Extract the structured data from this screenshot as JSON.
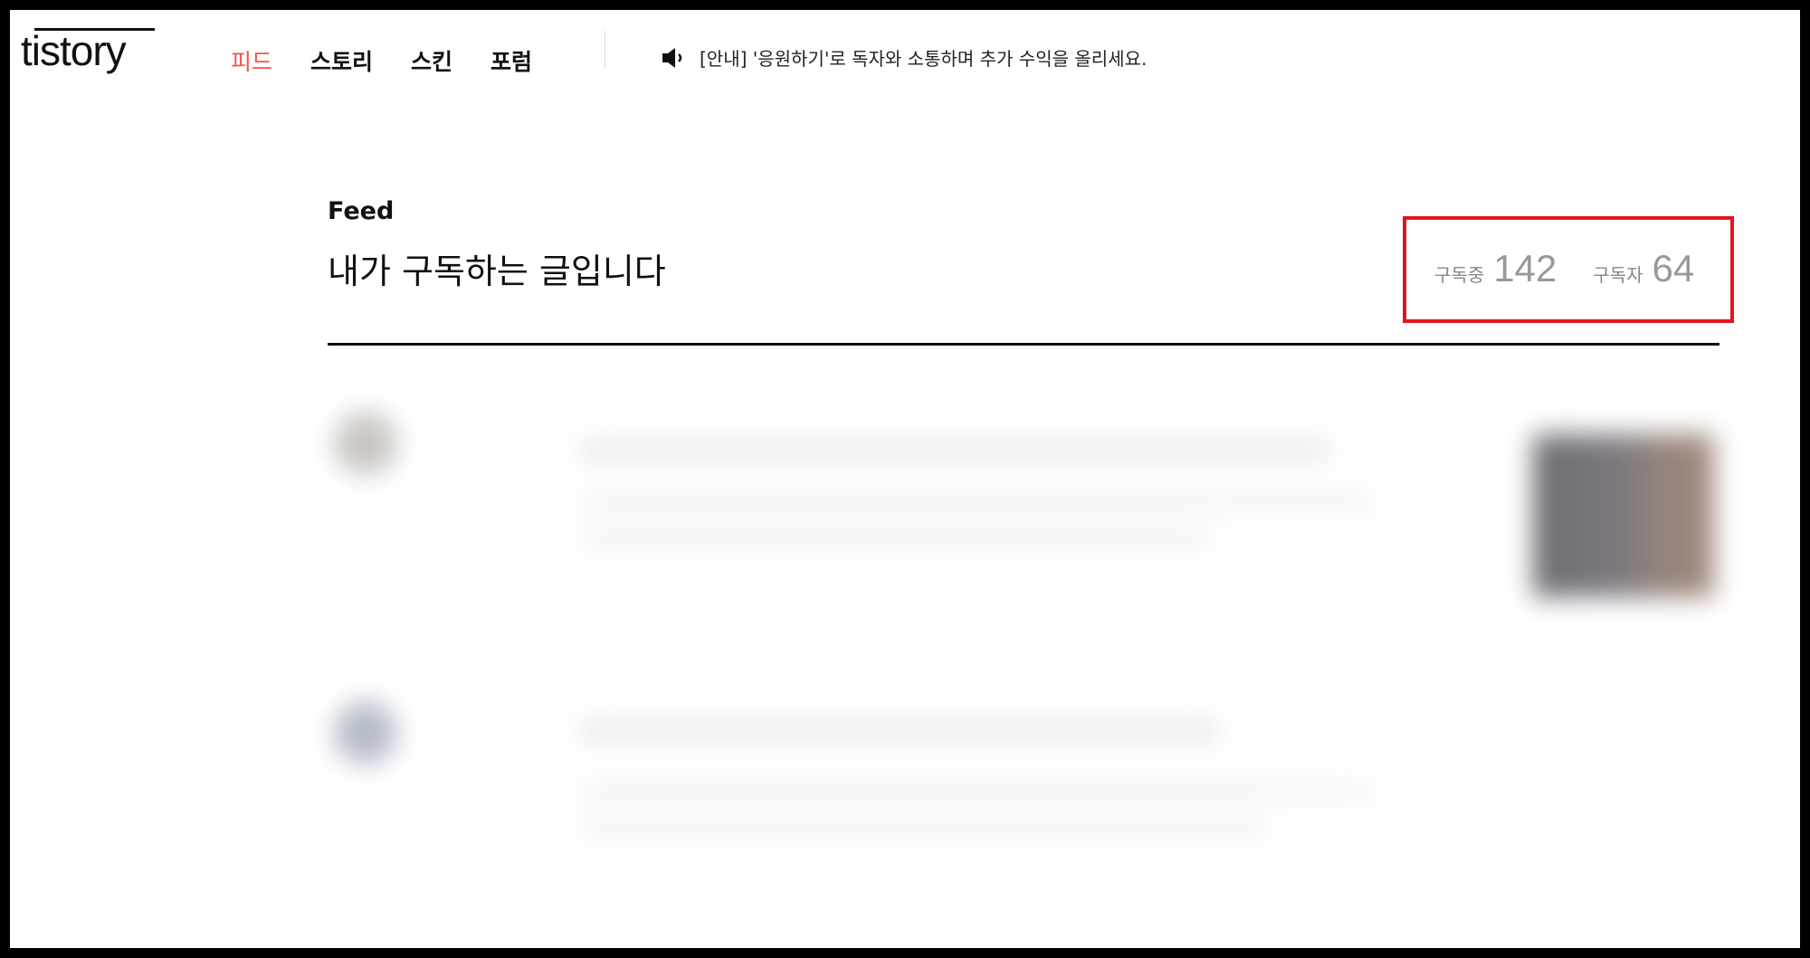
{
  "header": {
    "logo": "tistory",
    "nav": [
      {
        "label": "피드",
        "active": true
      },
      {
        "label": "스토리",
        "active": false
      },
      {
        "label": "스킨",
        "active": false
      },
      {
        "label": "포럼",
        "active": false
      }
    ],
    "notice": {
      "icon": "speaker-icon",
      "text": "[안내] '응원하기'로 독자와 소통하며 추가 수익을 올리세요."
    }
  },
  "feed": {
    "label": "Feed",
    "title": "내가 구독하는 글입니다",
    "stats": {
      "subscribing_label": "구독중",
      "subscribing_count": "142",
      "subscribers_label": "구독자",
      "subscribers_count": "64"
    }
  },
  "colors": {
    "accent": "#f2564b",
    "highlight_box": "#e4141e",
    "text": "#111111",
    "muted": "#999999"
  }
}
